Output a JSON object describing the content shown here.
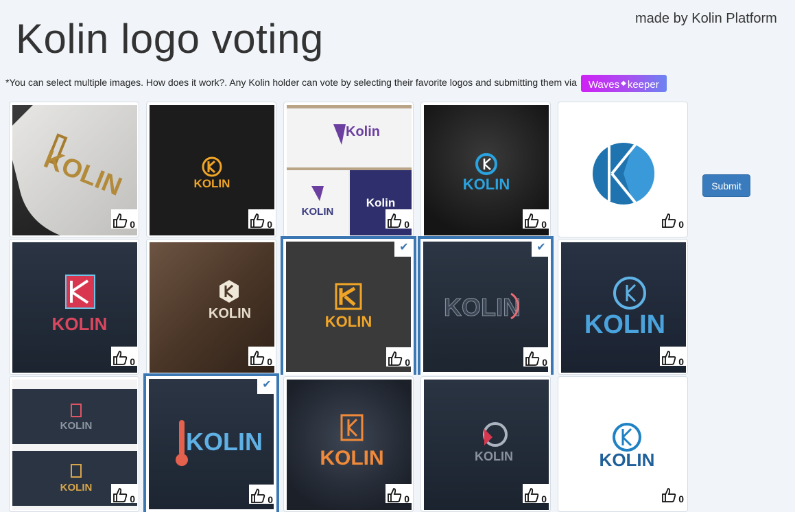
{
  "page": {
    "title": "Kolin logo voting",
    "made_by": "made by Kolin Platform",
    "intro": "*You can select multiple images. How does it work?. Any Kolin holder can vote by selecting their favorite logos and submitting them via",
    "waves_label_a": "Waves",
    "waves_label_b": "keeper",
    "submit_label": "Submit"
  },
  "logos": [
    {
      "word": "KOLIN",
      "votes": "0",
      "selected": false
    },
    {
      "word": "KOLIN",
      "votes": "0",
      "selected": false
    },
    {
      "word": "Kolin",
      "word2": "KOLIN",
      "word3": "Kolin",
      "votes": "0",
      "selected": false
    },
    {
      "word": "KOLIN",
      "votes": "0",
      "selected": false
    },
    {
      "word": "",
      "votes": "0",
      "selected": false
    },
    {
      "word": "KOLIN",
      "votes": "0",
      "selected": false
    },
    {
      "word": "KOLIN",
      "votes": "0",
      "selected": false
    },
    {
      "word": "KOLIN",
      "votes": "0",
      "selected": true
    },
    {
      "word": "KOLIN",
      "votes": "0",
      "selected": true
    },
    {
      "word": "KOLIN",
      "votes": "0",
      "selected": false
    },
    {
      "word": "KOLIN",
      "word2": "KOLIN",
      "votes": "0",
      "selected": false
    },
    {
      "word": "KOLIN",
      "votes": "0",
      "selected": true
    },
    {
      "word": "KOLIN",
      "votes": "0",
      "selected": false
    },
    {
      "word": "KOLIN",
      "votes": "0",
      "selected": false
    },
    {
      "word": "KOLIN",
      "votes": "0",
      "selected": false
    }
  ],
  "colors": {
    "accent": "#3b77b2",
    "submit_bg": "#3a7bbd",
    "waves_gradient_start": "#cf21f5",
    "waves_gradient_end": "#6b84f1",
    "page_bg": "#f1f5f9"
  },
  "icons": {
    "vote": "thumbs-up-icon",
    "selected": "check-icon",
    "waves": "diamond-icon"
  }
}
